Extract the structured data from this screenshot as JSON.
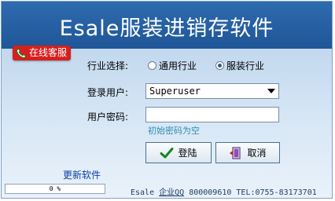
{
  "app": {
    "title": "Esale服装进销存软件"
  },
  "service_button": {
    "label": "在线客服"
  },
  "industry": {
    "label": "行业选择:",
    "options": [
      {
        "label": "通用行业",
        "selected": false
      },
      {
        "label": "服装行业",
        "selected": true
      }
    ]
  },
  "login": {
    "user_label": "登录用户:",
    "user_value": "Superuser",
    "password_label": "用户密码:",
    "password_value": "",
    "password_hint": "初始密码为空"
  },
  "buttons": {
    "login": "登陆",
    "cancel": "取消"
  },
  "update_link": "更新软件",
  "progress": {
    "value": 0,
    "text": "0 %"
  },
  "contact": {
    "prefix": "Esale ",
    "underlined": "企业QQ",
    "rest": " 800009610 TEL:0755-83173701"
  },
  "colors": {
    "header": "#1f5697",
    "service": "#d6201e",
    "hint": "#2f8db2",
    "link": "#0a3ea8"
  }
}
